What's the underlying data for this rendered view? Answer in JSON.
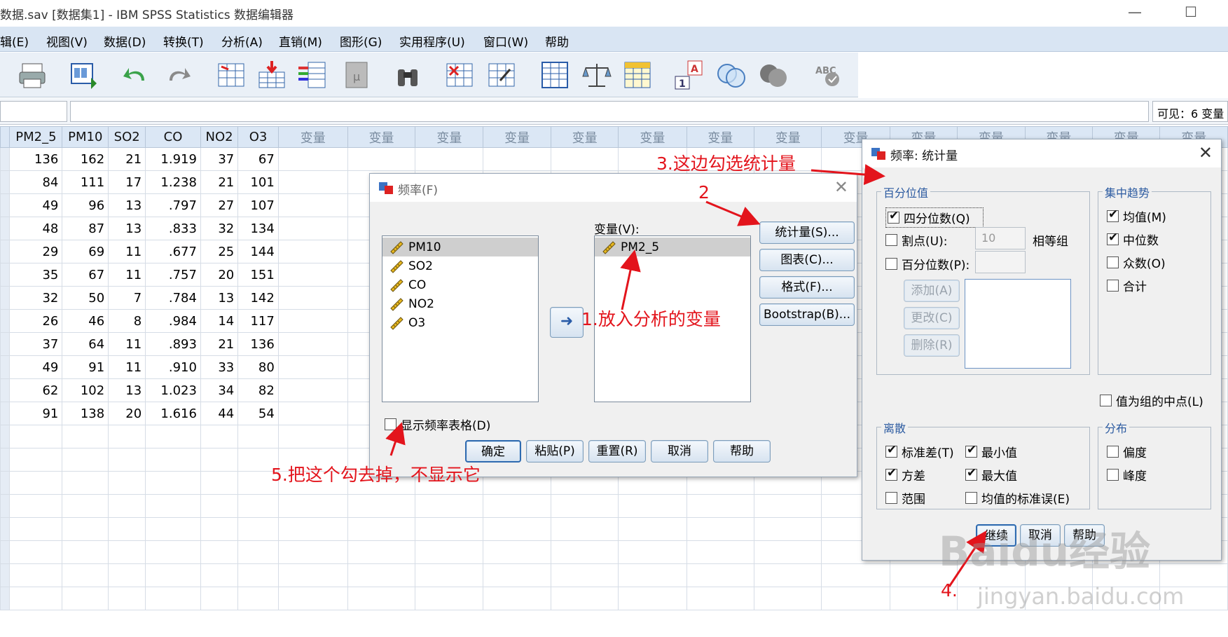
{
  "window": {
    "title": "数据.sav [数据集1] - IBM SPSS Statistics 数据编辑器",
    "minimize": "—",
    "maximize": "☐"
  },
  "menu": [
    "辑(E)",
    "视图(V)",
    "数据(D)",
    "转换(T)",
    "分析(A)",
    "直销(M)",
    "图形(G)",
    "实用程序(U)",
    "窗口(W)",
    "帮助"
  ],
  "status": {
    "visible": "可见：6 变量"
  },
  "grid": {
    "columns": [
      "PM2_5",
      "PM10",
      "SO2",
      "CO",
      "NO2",
      "O3",
      "变量",
      "变量",
      "变量",
      "变量",
      "变量",
      "变量",
      "变量",
      "变量",
      "变量",
      "变量",
      "变量",
      "变量",
      "变量",
      "变量"
    ],
    "rows": [
      [
        "136",
        "162",
        "21",
        "1.919",
        "37",
        "67"
      ],
      [
        "84",
        "111",
        "17",
        "1.238",
        "21",
        "101"
      ],
      [
        "49",
        "96",
        "13",
        ".797",
        "27",
        "107"
      ],
      [
        "48",
        "87",
        "13",
        ".833",
        "32",
        "134"
      ],
      [
        "29",
        "69",
        "11",
        ".677",
        "25",
        "144"
      ],
      [
        "35",
        "67",
        "11",
        ".757",
        "20",
        "151"
      ],
      [
        "32",
        "50",
        "7",
        ".784",
        "13",
        "142"
      ],
      [
        "26",
        "46",
        "8",
        ".984",
        "14",
        "117"
      ],
      [
        "37",
        "64",
        "11",
        ".893",
        "21",
        "136"
      ],
      [
        "49",
        "91",
        "11",
        ".910",
        "33",
        "80"
      ],
      [
        "62",
        "102",
        "13",
        "1.023",
        "34",
        "82"
      ],
      [
        "91",
        "138",
        "20",
        "1.616",
        "44",
        "54"
      ]
    ]
  },
  "freq_dialog": {
    "title": "频率(F)",
    "source_vars": [
      "PM10",
      "SO2",
      "CO",
      "NO2",
      "O3"
    ],
    "target_label": "变量(V):",
    "target_vars": [
      "PM2_5"
    ],
    "buttons": {
      "statistics": "统计量(S)...",
      "charts": "图表(C)...",
      "format": "格式(F)...",
      "bootstrap": "Bootstrap(B)...",
      "ok": "确定",
      "paste": "粘贴(P)",
      "reset": "重置(R)",
      "cancel": "取消",
      "help": "帮助"
    },
    "show_tables_label": "显示频率表格(D)",
    "show_tables_checked": false
  },
  "stats_dialog": {
    "title": "频率: 统计量",
    "percentile_group": "百分位值",
    "quartiles": {
      "label": "四分位数(Q)",
      "checked": true
    },
    "cutpoints": {
      "label": "割点(U):",
      "checked": false,
      "value": "10",
      "suffix": "相等组"
    },
    "percentiles": {
      "label": "百分位数(P):",
      "checked": false
    },
    "list_buttons": {
      "add": "添加(A)",
      "change": "更改(C)",
      "remove": "删除(R)"
    },
    "central_group": "集中趋势",
    "central": [
      {
        "label": "均值(M)",
        "checked": true
      },
      {
        "label": "中位数",
        "checked": true
      },
      {
        "label": "众数(O)",
        "checked": false
      },
      {
        "label": "合计",
        "checked": false
      }
    ],
    "midpoints": {
      "label": "值为组的中点(L)",
      "checked": false
    },
    "dispersion_group": "离散",
    "dispersion": [
      {
        "label": "标准差(T)",
        "checked": true
      },
      {
        "label": "最小值",
        "checked": true
      },
      {
        "label": "方差",
        "checked": true
      },
      {
        "label": "最大值",
        "checked": true
      },
      {
        "label": "范围",
        "checked": false
      },
      {
        "label": "均值的标准误(E)",
        "checked": false
      }
    ],
    "distribution_group": "分布",
    "distribution": [
      {
        "label": "偏度",
        "checked": false
      },
      {
        "label": "峰度",
        "checked": false
      }
    ],
    "buttons": {
      "continue": "继续",
      "cancel": "取消",
      "help": "帮助"
    }
  },
  "annotations": {
    "a1": "1.放入分析的变量",
    "a2": "2",
    "a3": "3.这边勾选统计量",
    "a4": "4.",
    "a5": "5.把这个勾去掉，不显示它"
  },
  "watermark": {
    "logo": "Baidu经验",
    "url": "jingyan.baidu.com"
  },
  "colors": {
    "annotation": "#e3141c",
    "menubar": "#d9e5f3",
    "accent": "#2f6bb0"
  }
}
